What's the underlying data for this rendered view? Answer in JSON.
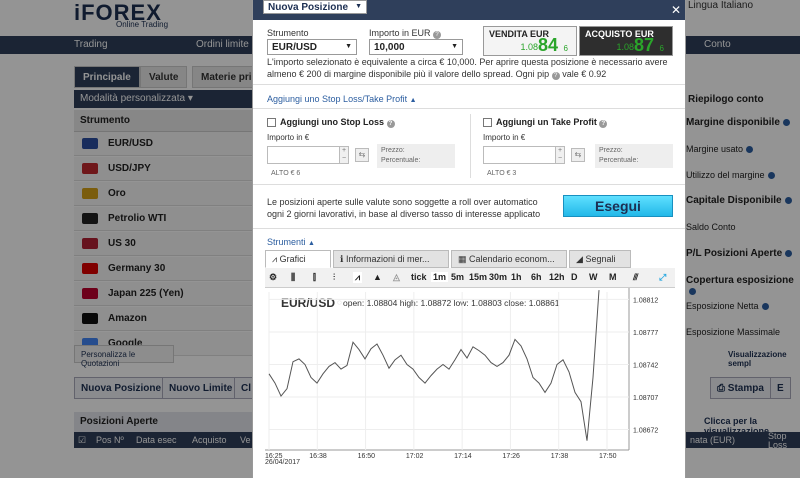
{
  "app": {
    "logo": "iFOREX",
    "logo_sub": "Online Trading",
    "language_label": "Lingua",
    "language_value": "Italiano"
  },
  "nav": [
    "Trading",
    "Ordini limite",
    "Conto"
  ],
  "tabs": [
    "Principale",
    "Valute",
    "Materie prim"
  ],
  "mode_select": "Modalità personalizzata",
  "instruments_header": "Strumento",
  "instruments": [
    {
      "name": "EUR/USD",
      "icon": "eu-us-flag-icon",
      "color": "#2b4fa0"
    },
    {
      "name": "USD/JPY",
      "icon": "us-jp-flag-icon",
      "color": "#c0282d"
    },
    {
      "name": "Oro",
      "icon": "gold-icon",
      "color": "#d4a017"
    },
    {
      "name": "Petrolio WTI",
      "icon": "oil-drop-icon",
      "color": "#222222"
    },
    {
      "name": "US 30",
      "icon": "us-flag-icon",
      "color": "#b22234"
    },
    {
      "name": "Germany 30",
      "icon": "de-flag-icon",
      "color": "#dd0000"
    },
    {
      "name": "Japan 225 (Yen)",
      "icon": "jp-flag-icon",
      "color": "#bc002d"
    },
    {
      "name": "Amazon",
      "icon": "amazon-icon",
      "color": "#111111"
    },
    {
      "name": "Google",
      "icon": "google-icon",
      "color": "#4285f4"
    }
  ],
  "personalize_label": "Personalizza le Quotazioni",
  "bottom_buttons": [
    "Nuova Posizione",
    "Nuovo Limite",
    "Cl",
    "Stampa",
    "E"
  ],
  "open_positions": {
    "title": "Posizioni Aperte",
    "link": "Clicca per la visualizzazione",
    "columns": [
      "Pos Nº",
      "Data esec",
      "Acquisto",
      "Ve",
      "nata (EUR)",
      "Stop Loss"
    ]
  },
  "account": {
    "title": "Riepilogo conto",
    "items": [
      "Margine disponibile",
      "Margine usato",
      "Utilizzo del margine",
      "Capitale Disponibile",
      "Saldo Conto",
      "P/L Posizioni Aperte",
      "Copertura esposizione",
      "Esposizione Netta",
      "Esposizione Massimale"
    ],
    "link": "Visualizzazione sempl"
  },
  "modal": {
    "title": "Nuova Posizione",
    "instrument_label": "Strumento",
    "instrument_value": "EUR/USD",
    "amount_label": "Importo in EUR",
    "amount_value": "10,000",
    "sell": {
      "label": "VENDITA EUR",
      "prefix": "1.08",
      "big": "84",
      "sup": "6"
    },
    "buy": {
      "label": "ACQUISTO EUR",
      "prefix": "1.08",
      "big": "87",
      "sup": "6"
    },
    "margin_note": "L'importo selezionato è equivalente a circa € 10,000. Per aprire questa posizione è necessario avere almeno € 200 di margine disponibile più il valore dello spread. Ogni pip",
    "pip_value": "vale € 0.92",
    "sltp_link": "Aggiungi uno Stop Loss/Take Profit",
    "stop_loss": {
      "label": "Aggiungi uno Stop Loss",
      "amount_label": "Importo in €",
      "price_label": "Prezzo:",
      "pct_label": "Percentuale:",
      "hint": "ALTO € 6"
    },
    "take_profit": {
      "label": "Aggiungi un Take Profit",
      "amount_label": "Importo in €",
      "price_label": "Prezzo:",
      "pct_label": "Percentuale:",
      "hint": "ALTO € 3"
    },
    "rollover_note": "Le posizioni aperte sulle valute sono soggette a roll over automatico ogni 2 giorni lavorativi, in base al diverso tasso di interesse applicato",
    "execute_label": "Esegui",
    "tools_label": "Strumenti",
    "tool_tabs": [
      "Grafici",
      "Informazioni di mer...",
      "Calendario econom...",
      "Segnali"
    ],
    "timeframes": [
      "tick",
      "1m",
      "5m",
      "15m",
      "30m",
      "1h",
      "6h",
      "12h",
      "D",
      "W",
      "M"
    ]
  },
  "chart_data": {
    "type": "line",
    "title": "EUR/USD",
    "ohlc": "open: 1.08804 high: 1.08872 low: 1.08803 close: 1.08861",
    "date_label": "26/04/2017",
    "x_ticks": [
      "16:25",
      "16:38",
      "16:50",
      "17:02",
      "17:14",
      "17:26",
      "17:38",
      "17:50"
    ],
    "y_ticks": [
      "1.08812",
      "1.08777",
      "1.08742",
      "1.08707",
      "1.08672"
    ],
    "ylim": [
      1.0865,
      1.0882
    ],
    "series": [
      {
        "values": [
          1.08732,
          1.08722,
          1.08708,
          1.08716,
          1.08745,
          1.08748,
          1.08742,
          1.08728,
          1.08722,
          1.08732,
          1.0874,
          1.08744,
          1.08737,
          1.08741,
          1.08766,
          1.08758,
          1.08748,
          1.08759,
          1.08764,
          1.08752,
          1.08738,
          1.08747,
          1.08752,
          1.08742,
          1.08737,
          1.08728,
          1.08722,
          1.0873,
          1.08737,
          1.08742,
          1.08737,
          1.08747,
          1.08758,
          1.08749,
          1.08761,
          1.08757,
          1.08752,
          1.08744,
          1.0874,
          1.08744,
          1.08752,
          1.08769,
          1.08762,
          1.08748,
          1.08728,
          1.08722,
          1.08712,
          1.08722,
          1.08742,
          1.08747,
          1.08734,
          1.08712,
          1.08702,
          1.0866,
          1.08728,
          1.08822
        ]
      }
    ]
  }
}
